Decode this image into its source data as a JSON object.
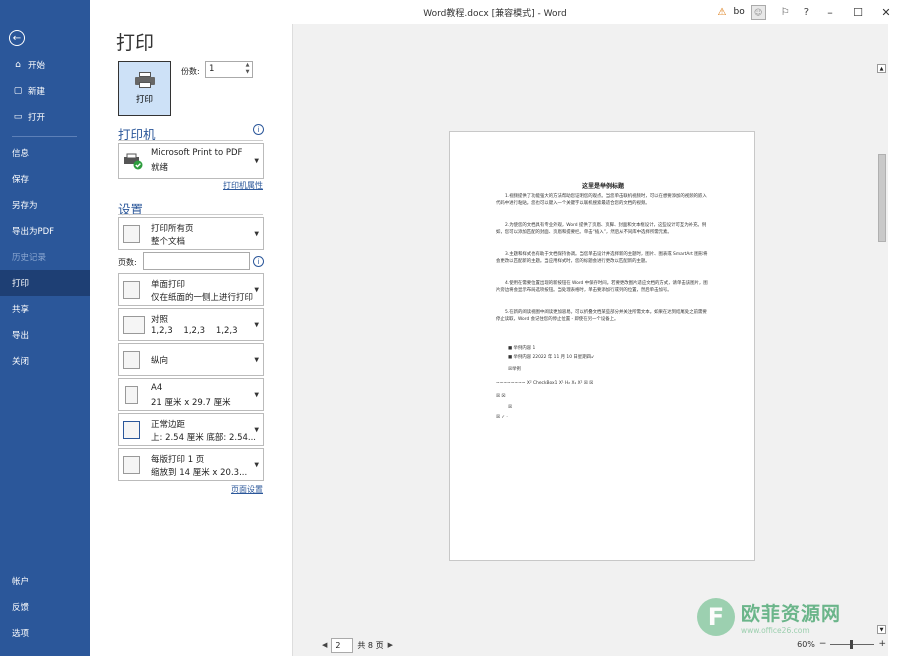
{
  "titlebar": {
    "title": "Word教程.docx [兼容模式] - Word",
    "user": "bo",
    "help": "?"
  },
  "sidebar": {
    "top_items": [
      {
        "label": "开始",
        "icon": "⌂"
      },
      {
        "label": "新建",
        "icon": "▢"
      },
      {
        "label": "打开",
        "icon": "▭"
      }
    ],
    "mid_items": [
      {
        "label": "信息"
      },
      {
        "label": "保存"
      },
      {
        "label": "另存为"
      },
      {
        "label": "导出为PDF"
      },
      {
        "label": "历史记录"
      },
      {
        "label": "打印"
      },
      {
        "label": "共享"
      },
      {
        "label": "导出"
      },
      {
        "label": "关闭"
      }
    ],
    "bottom_items": [
      {
        "label": "帐户"
      },
      {
        "label": "反馈"
      },
      {
        "label": "选项"
      }
    ]
  },
  "print": {
    "page_title": "打印",
    "print_button": "打印",
    "copies_label": "份数:",
    "copies_value": "1",
    "printer_heading": "打印机",
    "printer_name": "Microsoft Print to PDF",
    "printer_status": "就绪",
    "printer_props": "打印机属性",
    "settings_heading": "设置",
    "pages_label": "页数:",
    "page_setup_link": "页面设置",
    "settings": [
      {
        "line1": "打印所有页",
        "line2": "整个文档"
      },
      {
        "line1": "单面打印",
        "line2": "仅在纸面的一侧上进行打印"
      },
      {
        "line1": "对照",
        "line2": "1,2,3    1,2,3    1,2,3"
      },
      {
        "line1": "纵向",
        "line2": ""
      },
      {
        "line1": "A4",
        "line2": "21 厘米 x 29.7 厘米"
      },
      {
        "line1": "正常边距",
        "line2": "上: 2.54 厘米 底部: 2.54..."
      },
      {
        "line1": "每版打印 1 页",
        "line2": "缩放到 14 厘米 x 20.3..."
      }
    ]
  },
  "document": {
    "title": "这里是举例标题",
    "paragraphs": [
      "1.视频提供了功能强大的方法帮助您证明您的观点。当您单击联机视频时，可以在想要添加的视频的嵌入代码中进行粘贴。您也可以键入一个关键字以联机搜索最适合您的文档的视频。",
      "2.为使您的文档具有专业外观，Word 提供了页眉、页脚、封面和文本框设计，这些设计可互为补充。例如，您可以添加匹配的封面、页眉和提要栏。单击“插入”，然后从不同库中选择所需元素。",
      "3.主题和样式也有助于文档保持协调。当您单击设计并选择新的主题时，图片、图表或 SmartArt 图形将会更改以匹配新的主题。当应用样式时，您的标题会进行更改以匹配新的主题。",
      "4.使用在需要位置出现的新按钮在 Word 中保存时间。若要更改图片适应文档的方式，请单击该图片，图片旁边将会显示布局选项按钮。当处理表格时，单击要添加行或列的位置，然后单击加号。",
      "5.在新的阅读视图中阅读更加容易。可以折叠文档某些部分并关注所需文本。如果在达到结尾处之前需要停止读取，Word 会记住您的停止位置 - 即使在另一个设备上。"
    ],
    "bullets": [
      "举例内容 1",
      "举例内容 22022 年 11 月 10 日星期四↙"
    ],
    "checkbox_label": "举例",
    "misc_line": "~~~~~~~~   X²  CheckBox1     X¹     H₂    X₁  X²   ☒  ☒"
  },
  "pager": {
    "current": "2",
    "total": "共 8 页"
  },
  "zoom": {
    "percent": "60%",
    "minus": "−",
    "plus": "+"
  },
  "watermark": {
    "cn": "欧菲资源网",
    "url": "www.office26.com"
  },
  "colors": {
    "sidebar": "#2b579a",
    "accent": "#2b579a",
    "print_button_bg": "#cde1f7"
  }
}
